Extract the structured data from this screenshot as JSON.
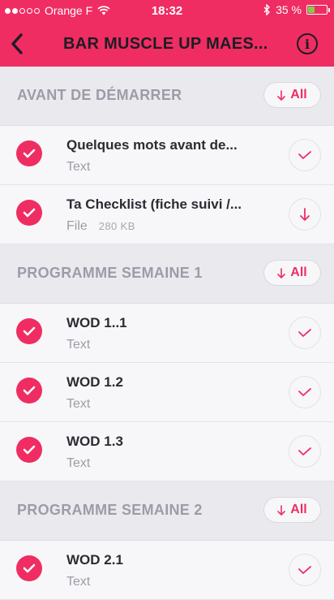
{
  "status_bar": {
    "signal_filled": 2,
    "signal_total": 5,
    "carrier": "Orange F",
    "time": "18:32",
    "battery_percent_label": "35 %",
    "battery_level": 0.35
  },
  "navbar": {
    "title": "BAR MUSCLE UP MAES...",
    "info_symbol": "i",
    "back_icon": "chevron-left-icon"
  },
  "sections": [
    {
      "label": "AVANT DE DÉMARRER",
      "all_label": "All",
      "items": [
        {
          "title": "Quelques mots avant de...",
          "type": "Text",
          "size": "",
          "action": "check-icon"
        },
        {
          "title": "Ta Checklist (fiche suivi /...",
          "type": "File",
          "size": "280 KB",
          "action": "download-icon"
        }
      ]
    },
    {
      "label": "PROGRAMME SEMAINE 1",
      "all_label": "All",
      "items": [
        {
          "title": "WOD 1..1",
          "type": "Text",
          "size": "",
          "action": "check-icon"
        },
        {
          "title": "WOD 1.2",
          "type": "Text",
          "size": "",
          "action": "check-icon"
        },
        {
          "title": "WOD 1.3",
          "type": "Text",
          "size": "",
          "action": "check-icon"
        }
      ]
    },
    {
      "label": "PROGRAMME SEMAINE 2",
      "all_label": "All",
      "items": [
        {
          "title": "WOD 2.1",
          "type": "Text",
          "size": "",
          "action": "check-icon"
        }
      ]
    }
  ],
  "colors": {
    "accent": "#ef2d63",
    "section_bg": "#eaeaee",
    "muted_text": "#9c9ca8"
  }
}
